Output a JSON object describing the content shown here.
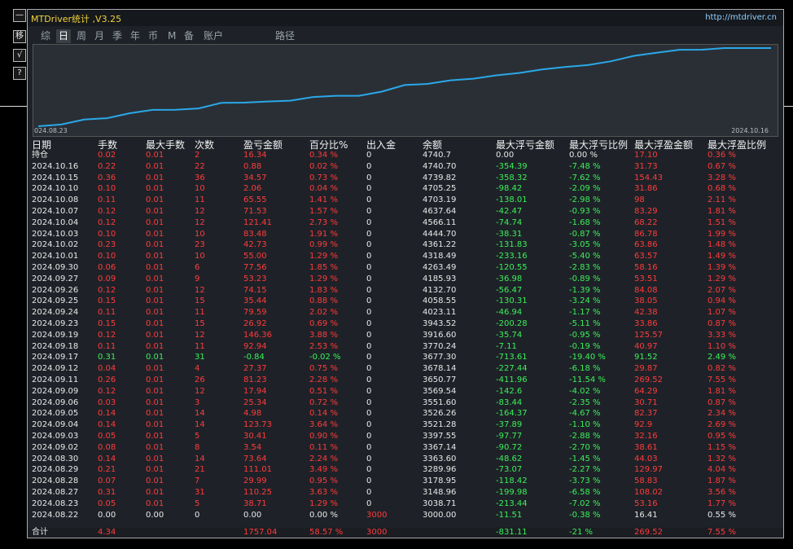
{
  "window": {
    "title": "MTDriver统计 ,V3.25",
    "url": "http://mtdriver.cn"
  },
  "side_buttons": [
    "—",
    "移",
    "√",
    "?"
  ],
  "tabs": [
    {
      "label": "综",
      "active": false
    },
    {
      "label": "日",
      "active": true
    },
    {
      "label": "周",
      "active": false
    },
    {
      "label": "月",
      "active": false
    },
    {
      "label": "季",
      "active": false
    },
    {
      "label": "年",
      "active": false
    },
    {
      "label": "币",
      "active": false
    },
    {
      "label": "M",
      "active": false
    },
    {
      "label": "备",
      "active": false
    },
    {
      "label": "账户",
      "active": false
    },
    {
      "label": "路径",
      "active": false
    }
  ],
  "chart": {
    "start_label": "024.08.23",
    "end_label": "2024.10.16",
    "line_color": "#2aa8e8",
    "equity": [
      3000.0,
      3038.71,
      3148.96,
      3178.95,
      3289.96,
      3363.6,
      3367.14,
      3397.55,
      3521.28,
      3526.26,
      3551.6,
      3569.54,
      3650.77,
      3678.14,
      3677.3,
      3770.24,
      3916.6,
      3943.52,
      4023.11,
      4058.55,
      4132.7,
      4185.93,
      4263.49,
      4318.49,
      4361.22,
      4444.7,
      4566.11,
      4637.64,
      4703.19,
      4705.25,
      4739.82,
      4740.7,
      4740.7
    ]
  },
  "table": {
    "headers": [
      "日期",
      "手数",
      "最大手数",
      "次数",
      "盈亏金额",
      "百分比%",
      "出入金",
      "余额",
      "最大浮亏金额",
      "最大浮亏比例",
      "最大浮盈金额",
      "最大浮盈比例"
    ],
    "rows": [
      {
        "color": "red",
        "cells": [
          "持仓",
          "0.02",
          "0.01",
          "2",
          "16.34",
          "0.34 %",
          "0",
          "4740.7",
          "0.00",
          "0.00 %",
          "17.10",
          "0.36 %"
        ]
      },
      {
        "color": "red",
        "cells": [
          "2024.10.16",
          "0.22",
          "0.01",
          "22",
          "0.88",
          "0.02 %",
          "0",
          "4740.70",
          "-354.39",
          "-7.48 %",
          "31.73",
          "0.67 %"
        ]
      },
      {
        "color": "red",
        "cells": [
          "2024.10.15",
          "0.36",
          "0.01",
          "36",
          "34.57",
          "0.73 %",
          "0",
          "4739.82",
          "-358.32",
          "-7.62 %",
          "154.43",
          "3.28 %"
        ]
      },
      {
        "color": "red",
        "cells": [
          "2024.10.10",
          "0.10",
          "0.01",
          "10",
          "2.06",
          "0.04 %",
          "0",
          "4705.25",
          "-98.42",
          "-2.09 %",
          "31.86",
          "0.68 %"
        ]
      },
      {
        "color": "red",
        "cells": [
          "2024.10.08",
          "0.11",
          "0.01",
          "11",
          "65.55",
          "1.41 %",
          "0",
          "4703.19",
          "-138.01",
          "-2.98 %",
          "98",
          "2.11 %"
        ]
      },
      {
        "color": "red",
        "cells": [
          "2024.10.07",
          "0.12",
          "0.01",
          "12",
          "71.53",
          "1.57 %",
          "0",
          "4637.64",
          "-42.47",
          "-0.93 %",
          "83.29",
          "1.81 %"
        ]
      },
      {
        "color": "red",
        "cells": [
          "2024.10.04",
          "0.12",
          "0.01",
          "12",
          "121.41",
          "2.73 %",
          "0",
          "4566.11",
          "-74.74",
          "-1.68 %",
          "68.22",
          "1.51 %"
        ]
      },
      {
        "color": "red",
        "cells": [
          "2024.10.03",
          "0.10",
          "0.01",
          "10",
          "83.48",
          "1.91 %",
          "0",
          "4444.70",
          "-38.31",
          "-0.87 %",
          "86.78",
          "1.99 %"
        ]
      },
      {
        "color": "red",
        "cells": [
          "2024.10.02",
          "0.23",
          "0.01",
          "23",
          "42.73",
          "0.99 %",
          "0",
          "4361.22",
          "-131.83",
          "-3.05 %",
          "63.86",
          "1.48 %"
        ]
      },
      {
        "color": "red",
        "cells": [
          "2024.10.01",
          "0.10",
          "0.01",
          "10",
          "55.00",
          "1.29 %",
          "0",
          "4318.49",
          "-233.16",
          "-5.40 %",
          "63.57",
          "1.49 %"
        ]
      },
      {
        "color": "red",
        "cells": [
          "2024.09.30",
          "0.06",
          "0.01",
          "6",
          "77.56",
          "1.85 %",
          "0",
          "4263.49",
          "-120.55",
          "-2.83 %",
          "58.16",
          "1.39 %"
        ]
      },
      {
        "color": "red",
        "cells": [
          "2024.09.27",
          "0.09",
          "0.01",
          "9",
          "53.23",
          "1.29 %",
          "0",
          "4185.93",
          "-36.98",
          "-0.89 %",
          "53.51",
          "1.29 %"
        ]
      },
      {
        "color": "red",
        "cells": [
          "2024.09.26",
          "0.12",
          "0.01",
          "12",
          "74.15",
          "1.83 %",
          "0",
          "4132.70",
          "-56.47",
          "-1.39 %",
          "84.08",
          "2.07 %"
        ]
      },
      {
        "color": "red",
        "cells": [
          "2024.09.25",
          "0.15",
          "0.01",
          "15",
          "35.44",
          "0.88 %",
          "0",
          "4058.55",
          "-130.31",
          "-3.24 %",
          "38.05",
          "0.94 %"
        ]
      },
      {
        "color": "red",
        "cells": [
          "2024.09.24",
          "0.11",
          "0.01",
          "11",
          "79.59",
          "2.02 %",
          "0",
          "4023.11",
          "-46.94",
          "-1.17 %",
          "42.38",
          "1.07 %"
        ]
      },
      {
        "color": "red",
        "cells": [
          "2024.09.23",
          "0.15",
          "0.01",
          "15",
          "26.92",
          "0.69 %",
          "0",
          "3943.52",
          "-200.28",
          "-5.11 %",
          "33.86",
          "0.87 %"
        ]
      },
      {
        "color": "red",
        "cells": [
          "2024.09.19",
          "0.12",
          "0.01",
          "12",
          "146.36",
          "3.88 %",
          "0",
          "3916.60",
          "-35.74",
          "-0.95 %",
          "125.57",
          "3.33 %"
        ]
      },
      {
        "color": "red",
        "cells": [
          "2024.09.18",
          "0.11",
          "0.01",
          "11",
          "92.94",
          "2.53 %",
          "0",
          "3770.24",
          "-7.11",
          "-0.19 %",
          "40.97",
          "1.10 %"
        ]
      },
      {
        "color": "green",
        "cells": [
          "2024.09.17",
          "0.31",
          "0.01",
          "31",
          "-0.84",
          "-0.02 %",
          "0",
          "3677.30",
          "-713.61",
          "-19.40 %",
          "91.52",
          "2.49 %"
        ]
      },
      {
        "color": "red",
        "cells": [
          "2024.09.12",
          "0.04",
          "0.01",
          "4",
          "27.37",
          "0.75 %",
          "0",
          "3678.14",
          "-227.44",
          "-6.18 %",
          "29.87",
          "0.82 %"
        ]
      },
      {
        "color": "red",
        "cells": [
          "2024.09.11",
          "0.26",
          "0.01",
          "26",
          "81.23",
          "2.28 %",
          "0",
          "3650.77",
          "-411.96",
          "-11.54 %",
          "269.52",
          "7.55 %"
        ]
      },
      {
        "color": "red",
        "cells": [
          "2024.09.09",
          "0.12",
          "0.01",
          "12",
          "17.94",
          "0.51 %",
          "0",
          "3569.54",
          "-142.6",
          "-4.02 %",
          "64.29",
          "1.81 %"
        ]
      },
      {
        "color": "red",
        "cells": [
          "2024.09.06",
          "0.03",
          "0.01",
          "3",
          "25.34",
          "0.72 %",
          "0",
          "3551.60",
          "-83.44",
          "-2.35 %",
          "30.71",
          "0.87 %"
        ]
      },
      {
        "color": "red",
        "cells": [
          "2024.09.05",
          "0.14",
          "0.01",
          "14",
          "4.98",
          "0.14 %",
          "0",
          "3526.26",
          "-164.37",
          "-4.67 %",
          "82.37",
          "2.34 %"
        ]
      },
      {
        "color": "red",
        "cells": [
          "2024.09.04",
          "0.14",
          "0.01",
          "14",
          "123.73",
          "3.64 %",
          "0",
          "3521.28",
          "-37.89",
          "-1.10 %",
          "92.9",
          "2.69 %"
        ]
      },
      {
        "color": "red",
        "cells": [
          "2024.09.03",
          "0.05",
          "0.01",
          "5",
          "30.41",
          "0.90 %",
          "0",
          "3397.55",
          "-97.77",
          "-2.88 %",
          "32.16",
          "0.95 %"
        ]
      },
      {
        "color": "red",
        "cells": [
          "2024.09.02",
          "0.08",
          "0.01",
          "8",
          "3.54",
          "0.11 %",
          "0",
          "3367.14",
          "-90.72",
          "-2.70 %",
          "38.61",
          "1.15 %"
        ]
      },
      {
        "color": "red",
        "cells": [
          "2024.08.30",
          "0.14",
          "0.01",
          "14",
          "73.64",
          "2.24 %",
          "0",
          "3363.60",
          "-48.62",
          "-1.45 %",
          "44.03",
          "1.32 %"
        ]
      },
      {
        "color": "red",
        "cells": [
          "2024.08.29",
          "0.21",
          "0.01",
          "21",
          "111.01",
          "3.49 %",
          "0",
          "3289.96",
          "-73.07",
          "-2.27 %",
          "129.97",
          "4.04 %"
        ]
      },
      {
        "color": "red",
        "cells": [
          "2024.08.28",
          "0.07",
          "0.01",
          "7",
          "29.99",
          "0.95 %",
          "0",
          "3178.95",
          "-118.42",
          "-3.73 %",
          "58.83",
          "1.87 %"
        ]
      },
      {
        "color": "red",
        "cells": [
          "2024.08.27",
          "0.31",
          "0.01",
          "31",
          "110.25",
          "3.63 %",
          "0",
          "3148.96",
          "-199.98",
          "-6.58 %",
          "108.02",
          "3.56 %"
        ]
      },
      {
        "color": "red",
        "cells": [
          "2024.08.23",
          "0.05",
          "0.01",
          "5",
          "38.71",
          "1.29 %",
          "0",
          "3038.71",
          "-213.44",
          "-7.02 %",
          "53.16",
          "1.77 %"
        ]
      },
      {
        "color": "white",
        "cells": [
          "2024.08.22",
          "0.00",
          "0.00",
          "0",
          "0.00",
          "0.00 %",
          "3000",
          "3000.00",
          "-11.51",
          "-0.38 %",
          "16.41",
          "0.55 %"
        ]
      }
    ],
    "summary": [
      "合计",
      "4.34",
      "",
      "",
      "1757.04",
      "58.57 %",
      "3000",
      "",
      "-831.11",
      "-21 %",
      "269.52",
      "7.55 %"
    ]
  }
}
